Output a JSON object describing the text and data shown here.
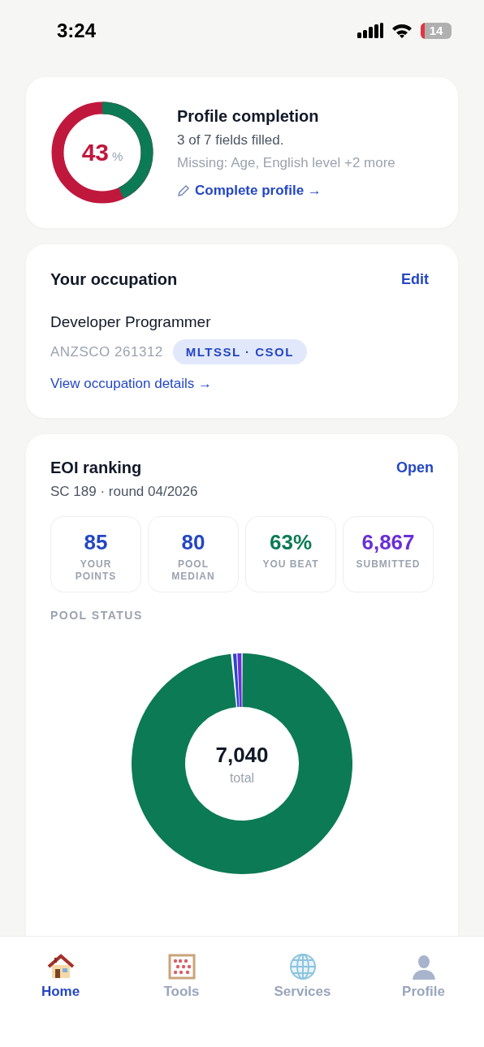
{
  "status_bar": {
    "time": "3:24",
    "battery": "14"
  },
  "profile_card": {
    "title": "Profile completion",
    "percent": "43",
    "percent_sign": "%",
    "level": 0.43,
    "summary": "3 of 7 fields filled.",
    "missing": "Missing: Age, English level +2 more",
    "link": "Complete profile →"
  },
  "occupation_card": {
    "title": "Your occupation",
    "action": "Edit",
    "name": "Developer Programmer",
    "code": "ANZSCO 261312",
    "badge": "MLTSSL · CSOL",
    "link": "View occupation details →"
  },
  "eoi_card": {
    "title": "EOI ranking",
    "action": "Open",
    "subtitle": "SC 189 · round 04/2026",
    "stats": [
      {
        "value": "85",
        "label": "YOUR POINTS",
        "color": "#2447c4"
      },
      {
        "value": "80",
        "label": "POOL MEDIAN",
        "color": "#2447c4"
      },
      {
        "value": "63%",
        "label": "YOU BEAT",
        "color": "#0b7a55"
      },
      {
        "value": "6,867",
        "label": "SUBMITTED",
        "color": "#6a2fd6"
      }
    ],
    "section_label": "POOL STATUS",
    "total": "7,040",
    "total_label": "total"
  },
  "tabs": [
    {
      "label": "Home",
      "kind": "house",
      "selected": true
    },
    {
      "label": "Tools",
      "kind": "abacus",
      "selected": false
    },
    {
      "label": "Services",
      "kind": "globe",
      "selected": false
    },
    {
      "label": "Profile",
      "kind": "person",
      "selected": false
    }
  ]
}
